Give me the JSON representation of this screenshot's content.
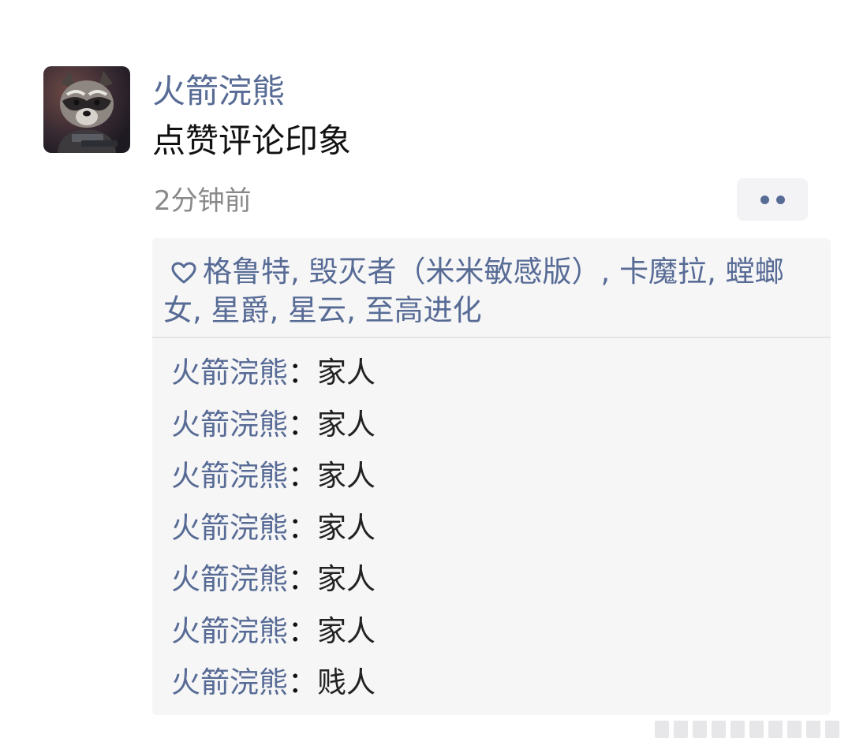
{
  "post": {
    "author": "火箭浣熊",
    "text": "点赞评论印象",
    "timestamp": "2分钟前",
    "avatar_icon": "raccoon-avatar-icon",
    "more_icon": "more-dots-icon"
  },
  "likes": {
    "icon": "heart-outline-icon",
    "users": [
      "格鲁特",
      "毁灭者（米米敏感版）",
      "卡魔拉",
      "螳螂女",
      "星爵",
      "星云",
      "至高进化"
    ],
    "separator": ", "
  },
  "comments": [
    {
      "author": "火箭浣熊",
      "colon": "：",
      "text": "家人"
    },
    {
      "author": "火箭浣熊",
      "colon": "：",
      "text": "家人"
    },
    {
      "author": "火箭浣熊",
      "colon": "：",
      "text": "家人"
    },
    {
      "author": "火箭浣熊",
      "colon": "：",
      "text": "家人"
    },
    {
      "author": "火箭浣熊",
      "colon": "：",
      "text": "家人"
    },
    {
      "author": "火箭浣熊",
      "colon": "：",
      "text": "家人"
    },
    {
      "author": "火箭浣熊",
      "colon": "：",
      "text": "贱人"
    }
  ],
  "colors": {
    "link": "#576b95",
    "text": "#111111",
    "muted": "#8a8a8a",
    "panel": "#f6f6f7"
  }
}
